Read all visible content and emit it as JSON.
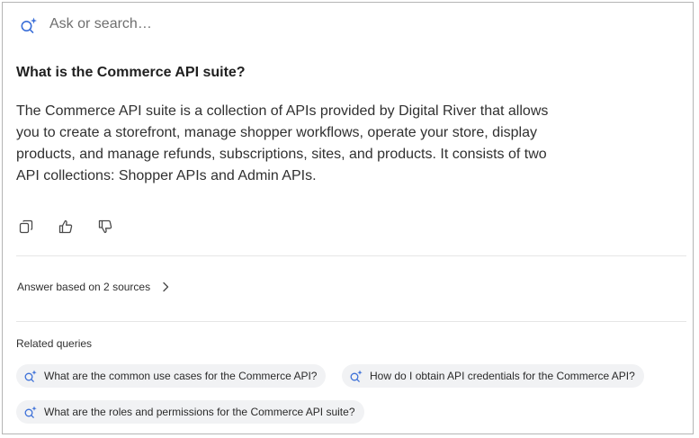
{
  "search": {
    "placeholder": "Ask or search…"
  },
  "question": "What is the Commerce API suite?",
  "answer": "The Commerce API suite is a collection of APIs provided by Digital River that allows you to create a storefront, manage shopper workflows, operate your store, display products, and manage refunds, subscriptions, sites, and products. It consists of two API collections: Shopper APIs and Admin APIs.",
  "actions": {
    "icons": [
      "copy-icon",
      "thumbs-up-icon",
      "thumbs-down-icon"
    ]
  },
  "sources": {
    "label": "Answer based on 2 sources"
  },
  "related": {
    "label": "Related queries",
    "queries": [
      "What are the common use cases for the Commerce API?",
      "How do I obtain API credentials for the Commerce API?",
      "What are the roles and permissions for the Commerce API suite?"
    ]
  },
  "colors": {
    "accent": "#3b6fd8",
    "icon": "#4a4a4a",
    "chip_bg": "#f1f2f4",
    "divider": "#e6e6e6"
  }
}
